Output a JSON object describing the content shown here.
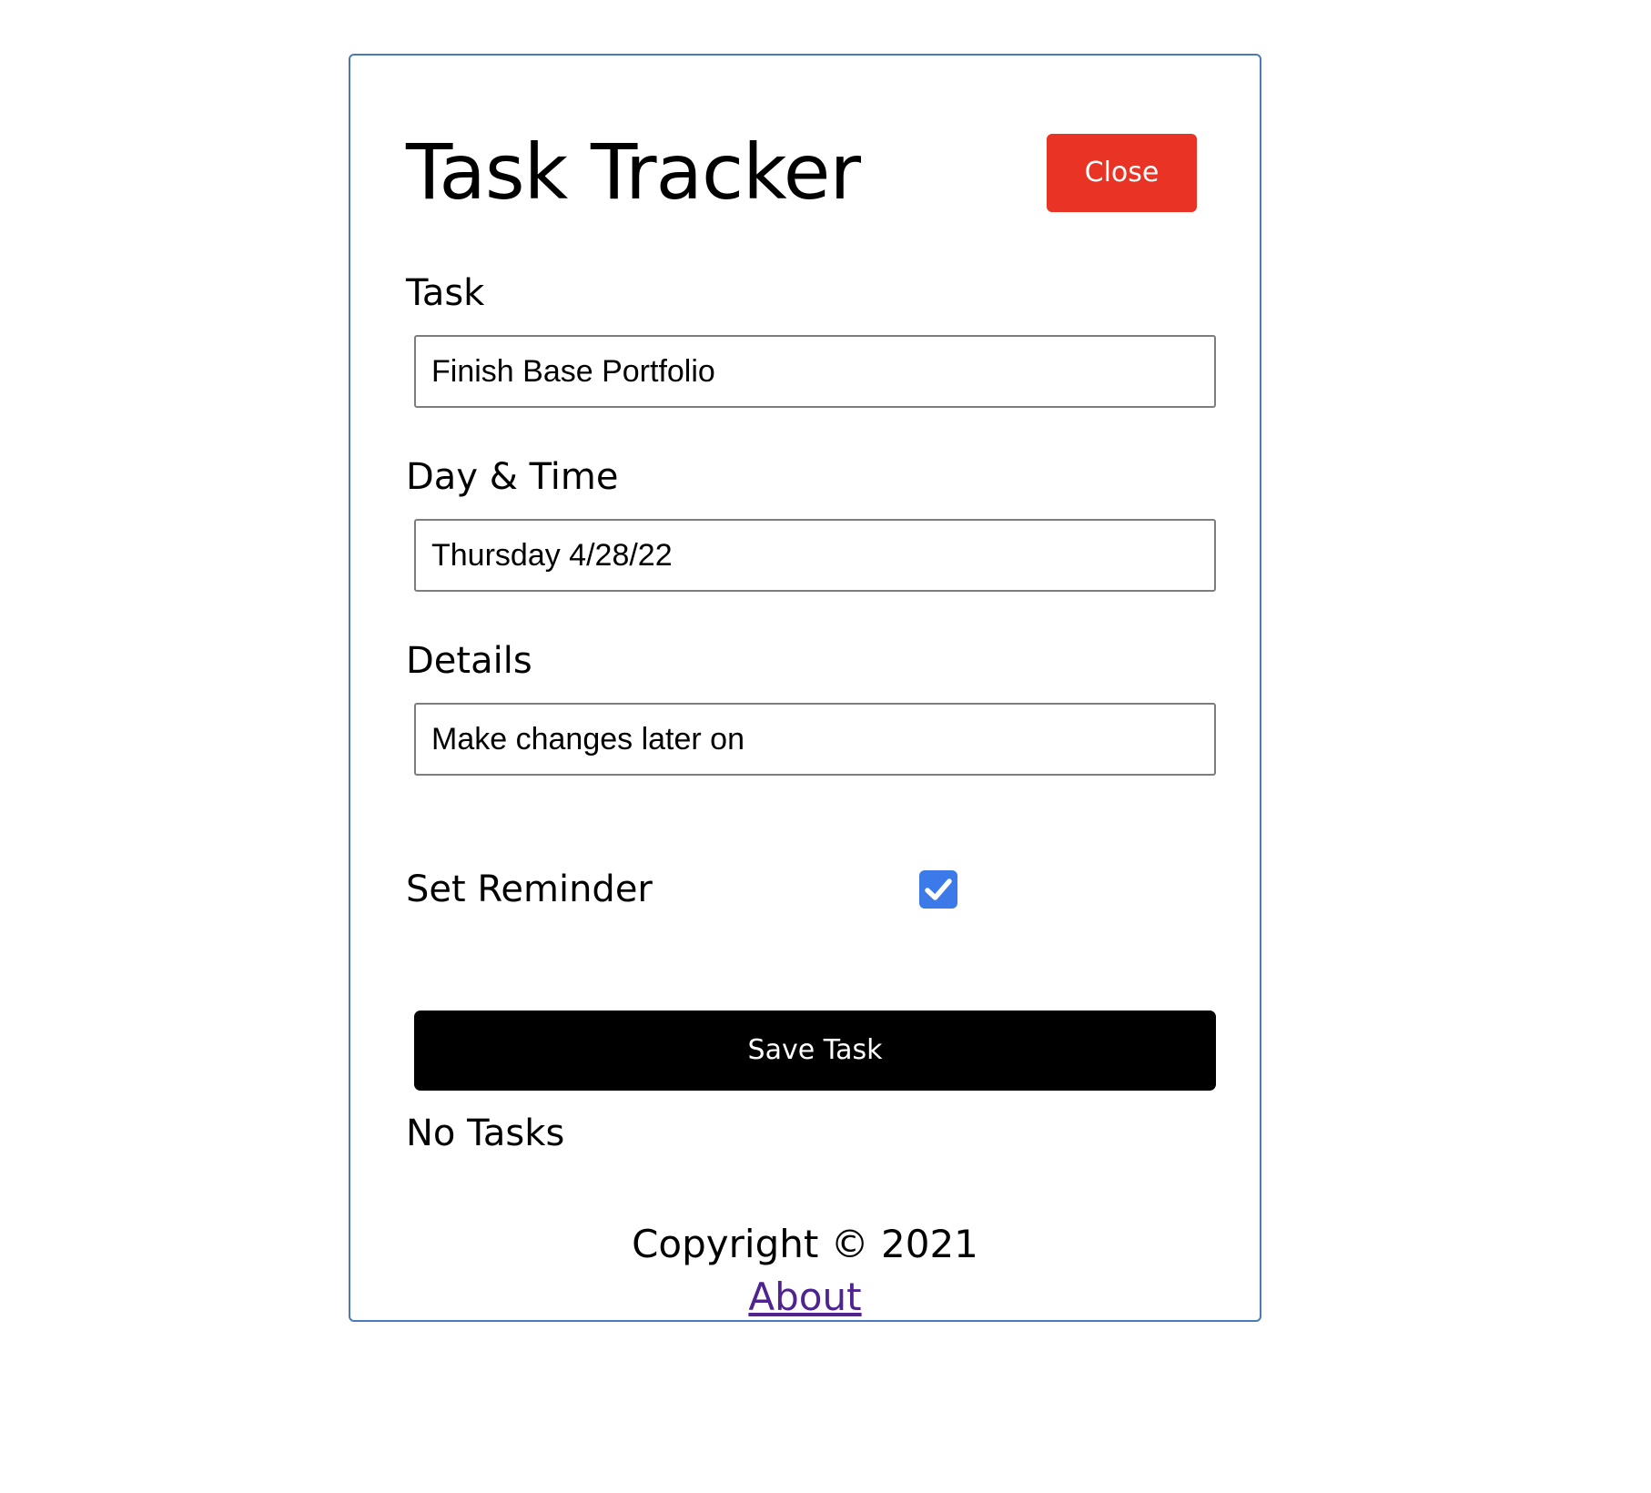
{
  "header": {
    "title": "Task Tracker",
    "close_label": "Close"
  },
  "form": {
    "task": {
      "label": "Task",
      "value": "Finish Base Portfolio"
    },
    "day_time": {
      "label": "Day & Time",
      "value": "Thursday 4/28/22"
    },
    "details": {
      "label": "Details",
      "value": "Make changes later on"
    },
    "reminder": {
      "label": "Set Reminder",
      "checked": true
    },
    "save_label": "Save Task"
  },
  "tasks": {
    "empty_text": "No Tasks"
  },
  "footer": {
    "copyright": "Copyright © 2021",
    "about_label": "About"
  },
  "colors": {
    "close_button": "#e93324",
    "save_button": "#000000",
    "checkbox": "#3b7ae8",
    "link": "#4f2490",
    "container_border": "#4a7ab8"
  }
}
